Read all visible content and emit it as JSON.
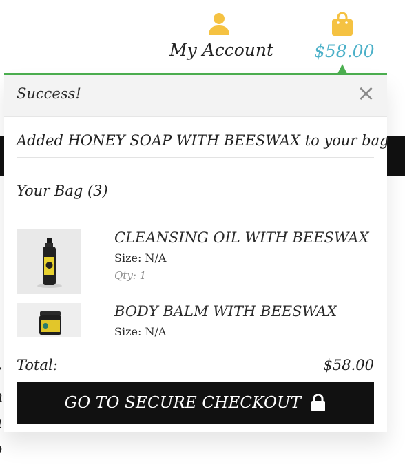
{
  "header": {
    "account_label": "My Account",
    "cart_total": "$58.00",
    "account_icon": "user-icon",
    "bag_icon": "shopping-bag-icon",
    "accent_color": "#f5c242",
    "total_color": "#4bb0c8",
    "line_color": "#4caf50"
  },
  "alert": {
    "title": "Success!",
    "close": "×"
  },
  "message": "Added HONEY SOAP WITH BEESWAX to your bag",
  "bag": {
    "heading": "Your Bag (3)",
    "items": [
      {
        "name": "CLEANSING OIL WITH BEESWAX",
        "size": "Size: N/A",
        "qty": "Qty: 1"
      },
      {
        "name": "BODY BALM WITH BEESWAX",
        "size": "Size: N/A",
        "qty": ""
      }
    ]
  },
  "total": {
    "label": "Total:",
    "value": "$58.00"
  },
  "checkout": {
    "label": "GO TO SECURE CHECKOUT",
    "icon": "lock-icon"
  },
  "background_fragments": [
    "r",
    "n",
    "a",
    "o"
  ]
}
